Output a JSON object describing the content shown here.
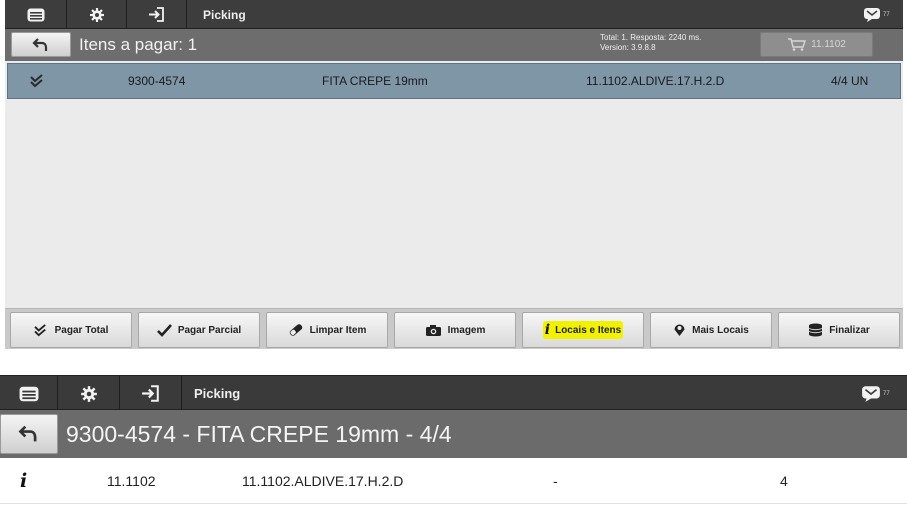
{
  "screen1": {
    "toolbar": {
      "menu_icon": "list-icon",
      "settings_icon": "gear-icon",
      "login_icon": "sign-in-icon",
      "title": "Picking",
      "message_icon": "message-icon",
      "badge": "77"
    },
    "header": {
      "back_icon": "back-arrow-icon",
      "title": "Itens a pagar: 1",
      "info_line1": "Total: 1. Resposta: 2240 ms.",
      "info_line2": "Version: 3.9.8.8",
      "cart_icon": "cart-icon",
      "cart_label": "11.1102"
    },
    "items": [
      {
        "check_icon": "double-check-icon",
        "code": "9300-4574",
        "description": "FITA CREPE 19mm",
        "location": "11.1102.ALDIVE.17.H.2.D",
        "quantity": "4/4 UN"
      }
    ],
    "actions": [
      {
        "label": "Pagar Total",
        "icon": "double-check-icon"
      },
      {
        "label": "Pagar Parcial",
        "icon": "check-icon"
      },
      {
        "label": "Limpar Item",
        "icon": "eraser-icon"
      },
      {
        "label": "Imagem",
        "icon": "camera-icon"
      },
      {
        "label": "Locais e Itens",
        "icon": "info-icon",
        "highlight": "#f2f200"
      },
      {
        "label": "Mais Locais",
        "icon": "map-marker-icon"
      },
      {
        "label": "Finalizar",
        "icon": "database-icon"
      }
    ]
  },
  "screen2": {
    "toolbar": {
      "title": "Picking",
      "badge": "77"
    },
    "header": {
      "title": "9300-4574 - FITA CREPE 19mm - 4/4"
    },
    "row": {
      "icon": "info-icon",
      "icon_glyph": "i",
      "col1": "11.1102",
      "col2": "11.1102.ALDIVE.17.H.2.D",
      "col3": "-",
      "col4": "4"
    }
  },
  "colors": {
    "toolbar_bg": "#3d3d3d",
    "header_bg": "#6d6d6d",
    "selected_row": "#7f96a7",
    "content_bg": "#ebebeb",
    "highlight": "#f2f200"
  }
}
